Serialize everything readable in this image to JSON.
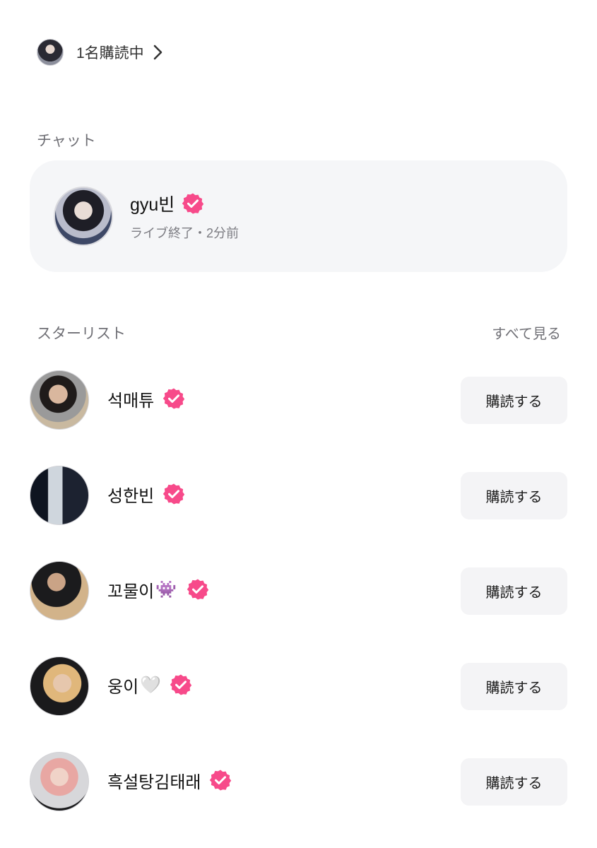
{
  "subscription": {
    "label": "1名購読中",
    "icon": "chevron-right-icon"
  },
  "chat": {
    "section_label": "チャット",
    "name": "gyu빈",
    "status": "ライブ終了・2分前",
    "verified": true
  },
  "star_list": {
    "section_label": "スターリスト",
    "see_all_label": "すべて見る",
    "subscribe_label": "購読する",
    "items": [
      {
        "name": "석매튜",
        "emoji": "",
        "verified": true
      },
      {
        "name": "성한빈",
        "emoji": "",
        "verified": true
      },
      {
        "name": "꼬물이",
        "emoji": "👾",
        "verified": true
      },
      {
        "name": "웅이",
        "emoji": "🤍",
        "verified": true
      },
      {
        "name": "흑설탕김태래",
        "emoji": "",
        "verified": true
      }
    ]
  },
  "colors": {
    "badge": "#f74a8a",
    "card_bg": "#f5f6f8",
    "button_bg": "#f4f4f6"
  }
}
